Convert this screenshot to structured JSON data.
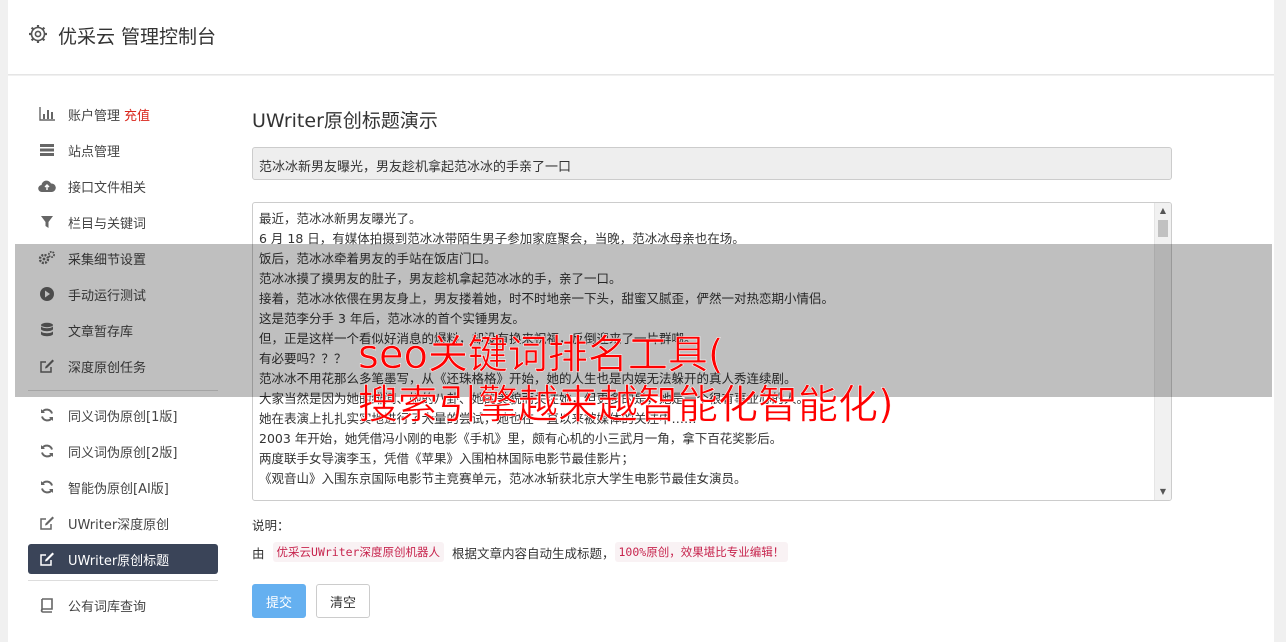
{
  "header": {
    "title": "优采云 管理控制台",
    "icon": "gear-icon"
  },
  "sidebar": {
    "group1": [
      {
        "label": "账户管理",
        "extra": "充值",
        "icon": "bar-chart-icon"
      },
      {
        "label": "站点管理",
        "icon": "server-icon"
      },
      {
        "label": "接口文件相关",
        "icon": "cloud-upload-icon"
      },
      {
        "label": "栏目与关键词",
        "icon": "filter-icon"
      },
      {
        "label": "采集细节设置",
        "icon": "gears-icon"
      },
      {
        "label": "手动运行测试",
        "icon": "play-circle-icon"
      },
      {
        "label": "文章暂存库",
        "icon": "database-icon"
      },
      {
        "label": "深度原创任务",
        "icon": "edit-icon"
      }
    ],
    "group2": [
      {
        "label": "同义词伪原创[1版]",
        "icon": "refresh-icon"
      },
      {
        "label": "同义词伪原创[2版]",
        "icon": "refresh-icon"
      },
      {
        "label": "智能伪原创[AI版]",
        "icon": "refresh-icon"
      },
      {
        "label": "UWriter深度原创",
        "icon": "edit-icon"
      },
      {
        "label": "UWriter原创标题",
        "icon": "edit-icon",
        "active": true
      }
    ],
    "group3": [
      {
        "label": "公有词库查询",
        "icon": "book-icon"
      }
    ]
  },
  "main": {
    "page_title": "UWriter原创标题演示",
    "title_value": "范冰冰新男友曝光，男友趁机拿起范冰冰的手亲了一口",
    "article_lines": [
      "最近，范冰冰新男友曝光了。",
      "6 月 18 日，有媒体拍摄到范冰冰带陌生男子参加家庭聚会，当晚，范冰冰母亲也在场。",
      "饭后，范冰冰牵着男友的手站在饭店门口。",
      "范冰冰摸了摸男友的肚子，男友趁机拿起范冰冰的手，亲了一口。",
      "接着，范冰冰依偎在男友身上，男友搂着她，时不时地亲一下头，甜蜜又腻歪，俨然一对热恋期小情侣。",
      "这是范李分手 3 年后，范冰冰的首个实锤男友。",
      "但，正是这样一个看似好消息的爆料，却没有换来祝福，反倒迎来了一片群嘲。",
      "有必要吗？？？",
      "范冰冰不用花那么多笔墨写，从《还珠格格》开始，她的人生也是内娱无法躲开的真人秀连续剧。",
      "大家当然是因为她的绯闻、她的八卦、她的美貌而关注她，但更多的是，她是一个很有事业心的人。",
      "她在表演上扎扎实实地进行了大量的尝试，她也在一直以来被媒体的关注中……",
      "2003 年开始，她凭借冯小刚的电影《手机》里，颇有心机的小三武月一角，拿下百花奖影后。",
      "两度联手女导演李玉，凭借《苹果》入围柏林国际电影节最佳影片；",
      "《观音山》入围东京国际电影节主竞赛单元，范冰冰斩获北京大学生电影节最佳女演员。"
    ],
    "explain_label": "说明：",
    "explain_prefix": "由",
    "explain_code1": "优采云UWriter深度原创机器人",
    "explain_middle": "根据文章内容自动生成标题，",
    "explain_code2": "100%原创，效果堪比专业编辑！",
    "submit_label": "提交",
    "clear_label": "清空"
  },
  "watermark": {
    "line1": "seo关键词排名工具(",
    "line2": "搜索引擎越来越智能化智能化)"
  }
}
